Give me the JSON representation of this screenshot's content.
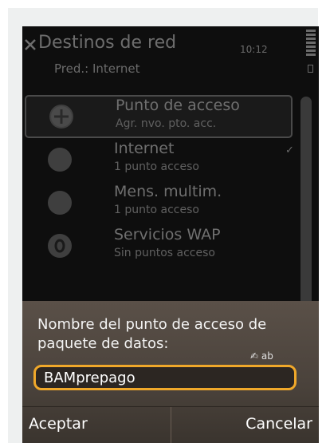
{
  "header": {
    "title": "Destinos de red",
    "subtitle": "Pred.: Internet",
    "clock": "10:12"
  },
  "list": {
    "items": [
      {
        "title": "Punto de acceso",
        "subtitle": "Agr. nvo. pto. acc.",
        "icon": "add-access-point-icon"
      },
      {
        "title": "Internet",
        "subtitle": "1 punto acceso",
        "icon": "globe-icon"
      },
      {
        "title": "Mens. multim.",
        "subtitle": "1 punto acceso",
        "icon": "mms-icon"
      },
      {
        "title": "Servicios WAP",
        "subtitle": "Sin puntos acceso",
        "icon": "wap-icon"
      }
    ]
  },
  "dialog": {
    "label": "Nombre del punto de acceso de paquete de datos:",
    "input_mode": "✍ ab",
    "input_value": "BAMprepago"
  },
  "softkeys": {
    "left": "Aceptar",
    "right": "Cancelar"
  },
  "colors": {
    "highlight": "#f0a82a",
    "dialog_bg": "#4a423b",
    "screen_bg": "#0e0e0e"
  }
}
